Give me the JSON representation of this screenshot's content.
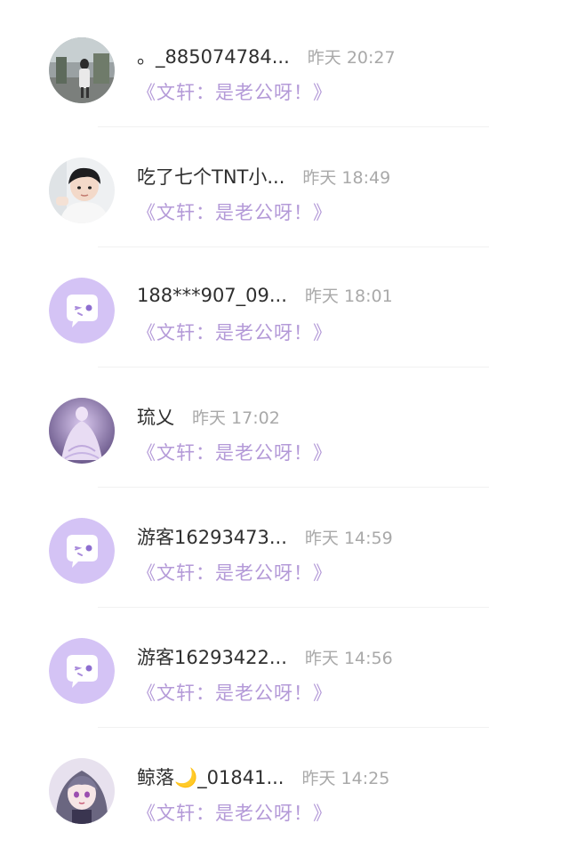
{
  "messages": [
    {
      "name": "。_885074784...",
      "time": "昨天 20:27",
      "snippet": "《文轩：是老公呀！》",
      "avatar": "photo-street"
    },
    {
      "name": "吃了七个TNT小...",
      "time": "昨天 18:49",
      "snippet": "《文轩：是老公呀！》",
      "avatar": "photo-boy"
    },
    {
      "name": "188***907_09...",
      "time": "昨天 18:01",
      "snippet": "《文轩：是老公呀！》",
      "avatar": "default-chat-bubble"
    },
    {
      "name": "琉乂",
      "time": "昨天 17:02",
      "snippet": "《文轩：是老公呀！》",
      "avatar": "photo-dress"
    },
    {
      "name": "游客16293473...",
      "time": "昨天 14:59",
      "snippet": "《文轩：是老公呀！》",
      "avatar": "default-chat-bubble"
    },
    {
      "name": "游客16293422...",
      "time": "昨天 14:56",
      "snippet": "《文轩：是老公呀！》",
      "avatar": "default-chat-bubble"
    },
    {
      "name": "鲸落🌙_01841...",
      "time": "昨天 14:25",
      "snippet": "《文轩：是老公呀！》",
      "avatar": "photo-anime-girl"
    }
  ],
  "colors": {
    "snippet": "#b49ad8",
    "time": "#a9a9a9",
    "name": "#2f2f2f",
    "default_avatar_bg": "#d4c3f5"
  }
}
